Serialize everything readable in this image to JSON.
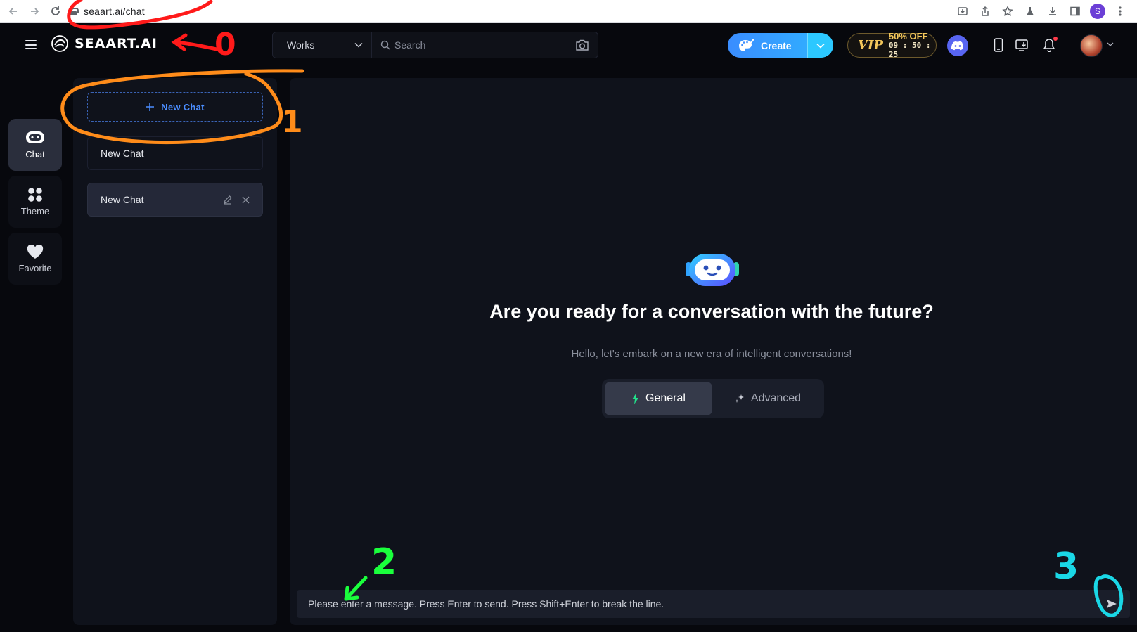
{
  "browser": {
    "url": "seaart.ai/chat"
  },
  "header": {
    "brand": "SEAART.AI",
    "works_select": "Works",
    "search_placeholder": "Search",
    "create_label": "Create",
    "vip": {
      "mark": "VIP",
      "discount": "50% OFF",
      "countdown": "09 : 50 : 25"
    }
  },
  "rail": {
    "items": [
      {
        "label": "Chat",
        "icon": "chat-bot-icon",
        "active": true
      },
      {
        "label": "Theme",
        "icon": "grid-dots-icon",
        "active": false
      },
      {
        "label": "Favorite",
        "icon": "heart-icon",
        "active": false
      }
    ]
  },
  "chat_list": {
    "new_chat_button": "New Chat",
    "items": [
      {
        "title": "New Chat",
        "selected": false
      },
      {
        "title": "New Chat",
        "selected": true
      }
    ]
  },
  "main": {
    "title": "Are you ready for a conversation with the future?",
    "subtitle": "Hello, let's embark on a new era of intelligent conversations!",
    "modes": [
      {
        "label": "General",
        "icon": "lightning-icon",
        "active": true
      },
      {
        "label": "Advanced",
        "icon": "sparkle-icon",
        "active": false
      }
    ],
    "composer_placeholder": "Please enter a message. Press Enter to send. Press Shift+Enter to break the line."
  },
  "annotations": {
    "marks": [
      "0",
      "1",
      "2",
      "3"
    ],
    "colors": {
      "red": "#ff1a1a",
      "orange": "#ff8c1a",
      "green": "#1aff3c",
      "cyan": "#1ad7e6"
    }
  },
  "colors": {
    "accent_blue": "#3a8dff",
    "vip_gold": "#f3c75b",
    "panel_bg": "#0f121b",
    "page_bg": "#07080d"
  }
}
